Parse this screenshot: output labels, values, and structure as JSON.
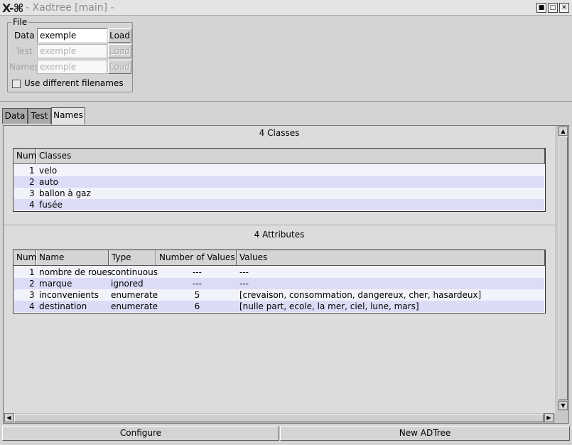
{
  "window": {
    "title": "- Xadtree [main] -",
    "logo": "X-⌘",
    "controls": [
      "■",
      "□",
      "✕"
    ]
  },
  "file": {
    "legend": "File",
    "rows": [
      {
        "label": "Data",
        "value": "exemple",
        "button": "Load",
        "enabled": true
      },
      {
        "label": "Test",
        "value": "exemple",
        "button": "Load",
        "enabled": false
      },
      {
        "label": "Names",
        "value": "exemple",
        "button": "Load",
        "enabled": false
      }
    ],
    "checkbox_label": "Use different filenames"
  },
  "tabs": [
    {
      "label": "Data",
      "active": false
    },
    {
      "label": "Test",
      "active": false
    },
    {
      "label": "Names",
      "active": true
    }
  ],
  "classes": {
    "title": "4 Classes",
    "headers": [
      "Num",
      "Classes"
    ],
    "rows": [
      [
        "1",
        "velo"
      ],
      [
        "2",
        "auto"
      ],
      [
        "3",
        "ballon à gaz"
      ],
      [
        "4",
        "fusée"
      ]
    ]
  },
  "attributes": {
    "title": "4 Attributes",
    "headers": [
      "Num",
      "Name",
      "Type",
      "Number of Values",
      "Values"
    ],
    "rows": [
      [
        "1",
        "nombre de roues",
        "continuous",
        "---",
        "---"
      ],
      [
        "2",
        "marque",
        "ignored",
        "---",
        "---"
      ],
      [
        "3",
        "inconvenients",
        "enumerate",
        "5",
        "[crevaison, consommation, dangereux, cher, hasardeux]"
      ],
      [
        "4",
        "destination",
        "enumerate",
        "6",
        "[nulle part, ecole, la mer, ciel, lune, mars]"
      ]
    ]
  },
  "bottom": {
    "configure": "Configure",
    "new_adtree": "New ADTree"
  },
  "icons": {
    "scroll_up": "▲",
    "scroll_down": "▼",
    "scroll_left": "◀",
    "scroll_right": "▶"
  }
}
